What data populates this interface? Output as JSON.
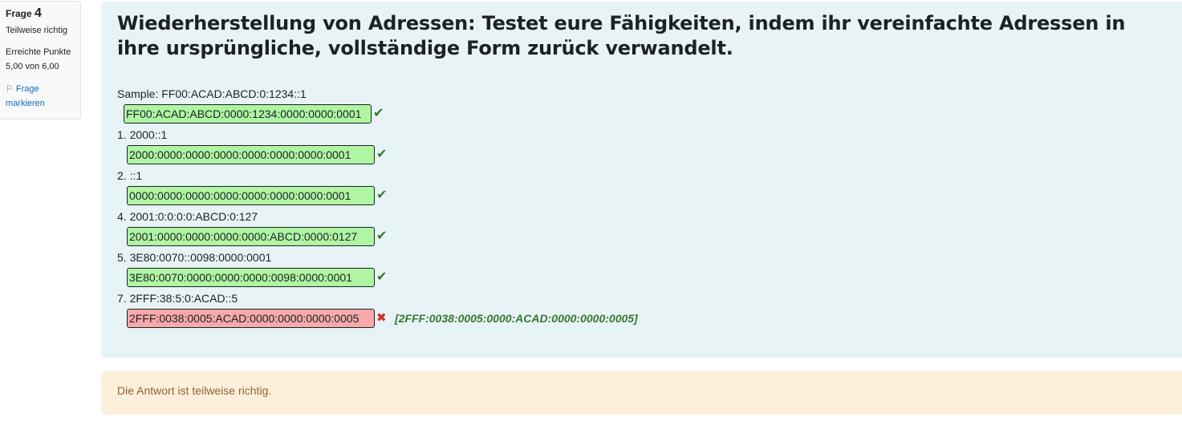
{
  "info": {
    "question_label": "Frage",
    "question_number": "4",
    "state": "Teilweise richtig",
    "grade_label": "Erreichte Punkte",
    "grade_value": "5,00 von 6,00",
    "flag_line1": "Frage",
    "flag_line2": "markieren",
    "flag_icon": "flag-icon"
  },
  "question": {
    "text": "Wiederherstellung von Adressen: Testet eure Fähigkeiten, indem ihr vereinfachte Adressen in ihre ursprüngliche, vollständige Form zurück verwandelt."
  },
  "items": [
    {
      "label": "Sample: FF00:ACAD:ABCD:0:1234::1",
      "answer": "FF00:ACAD:ABCD:0000:1234:0000:0000:0001",
      "status": "correct",
      "mark": "✔"
    },
    {
      "label": "1. 2000::1",
      "answer": "2000:0000:0000:0000:0000:0000:0000:0001",
      "status": "correct",
      "mark": "✔"
    },
    {
      "label": "2. ::1",
      "answer": "0000:0000:0000:0000:0000:0000:0000:0001",
      "status": "correct",
      "mark": "✔"
    },
    {
      "label": "4. 2001:0:0:0:0:ABCD:0:127",
      "answer": "2001:0000:0000:0000:0000:ABCD:0000:0127",
      "status": "correct",
      "mark": "✔"
    },
    {
      "label": "5. 3E80:0070::0098:0000:0001",
      "answer": "3E80:0070:0000:0000:0000:0098:0000:0001",
      "status": "correct",
      "mark": "✔"
    },
    {
      "label": "7. 2FFF:38:5:0:ACAD::5",
      "answer": "2FFF:0038:0005:ACAD:0000:0000:0000:0005",
      "status": "incorrect",
      "mark": "✖",
      "right_answer": "[2FFF:0038:0005:0000:ACAD:0000:0000:0005]"
    }
  ],
  "feedback": {
    "text": "Die Antwort ist teilweise richtig."
  },
  "colors": {
    "correct_bg": "#aff5a3",
    "incorrect_bg": "#f8a9ab",
    "correct_mark": "#357a32",
    "incorrect_mark": "#ca3120",
    "panel_bg": "#e7f3f5",
    "feedback_bg": "#fcefdc"
  }
}
